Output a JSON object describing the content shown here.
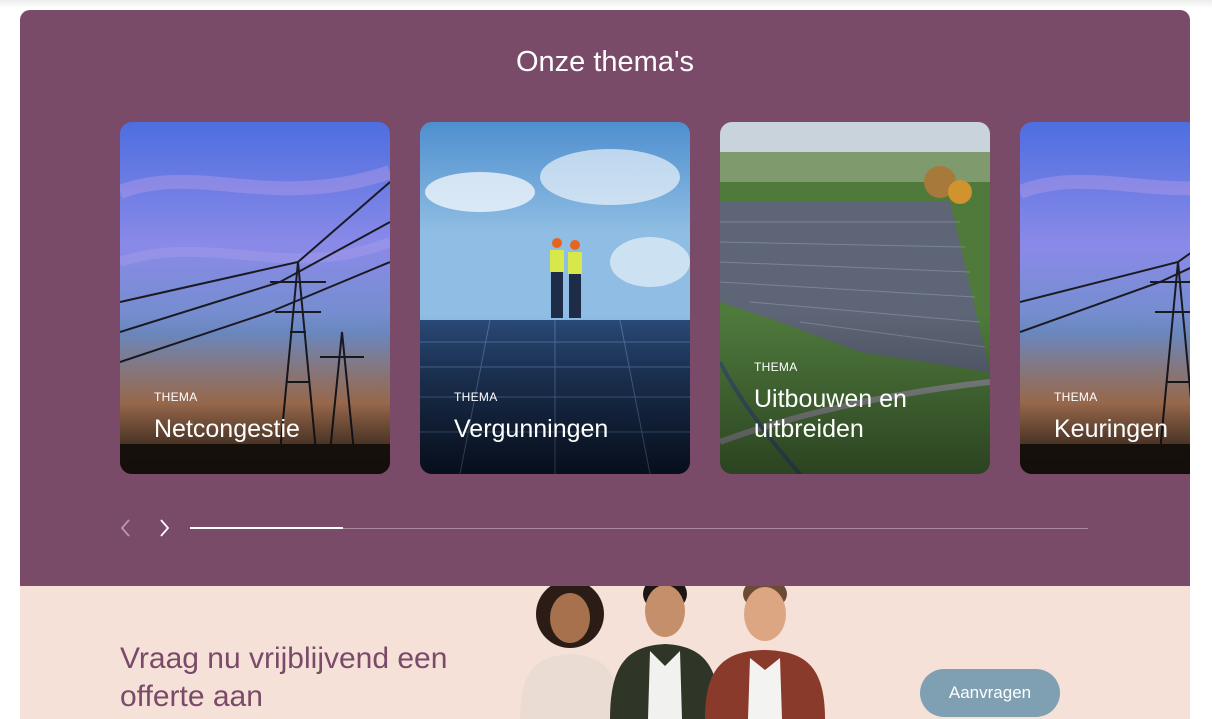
{
  "themes": {
    "title": "Onze thema's",
    "cards": [
      {
        "kicker": "THEMA",
        "name": "Netcongestie",
        "image": "power-lines-sunset"
      },
      {
        "kicker": "THEMA",
        "name": "Vergunningen",
        "image": "engineers-on-solar-roof"
      },
      {
        "kicker": "THEMA",
        "name": "Uitbouwen en uitbreiden",
        "image": "solar-park-aerial"
      },
      {
        "kicker": "THEMA",
        "name": "Keuringen",
        "image": "power-lines-sunset"
      }
    ],
    "carousel": {
      "prev_icon": "chevron-left-icon",
      "next_icon": "chevron-right-icon",
      "progress": 0.17
    }
  },
  "cta": {
    "text": "Vraag nu vrijblijvend een offerte aan",
    "button_label": "Aanvragen",
    "image": "three-people-portrait"
  },
  "colors": {
    "theme_bg": "#7a4a69",
    "cta_bg": "#f6e1d9",
    "button": "#7f9fb2",
    "text_purple": "#7a4a69"
  }
}
